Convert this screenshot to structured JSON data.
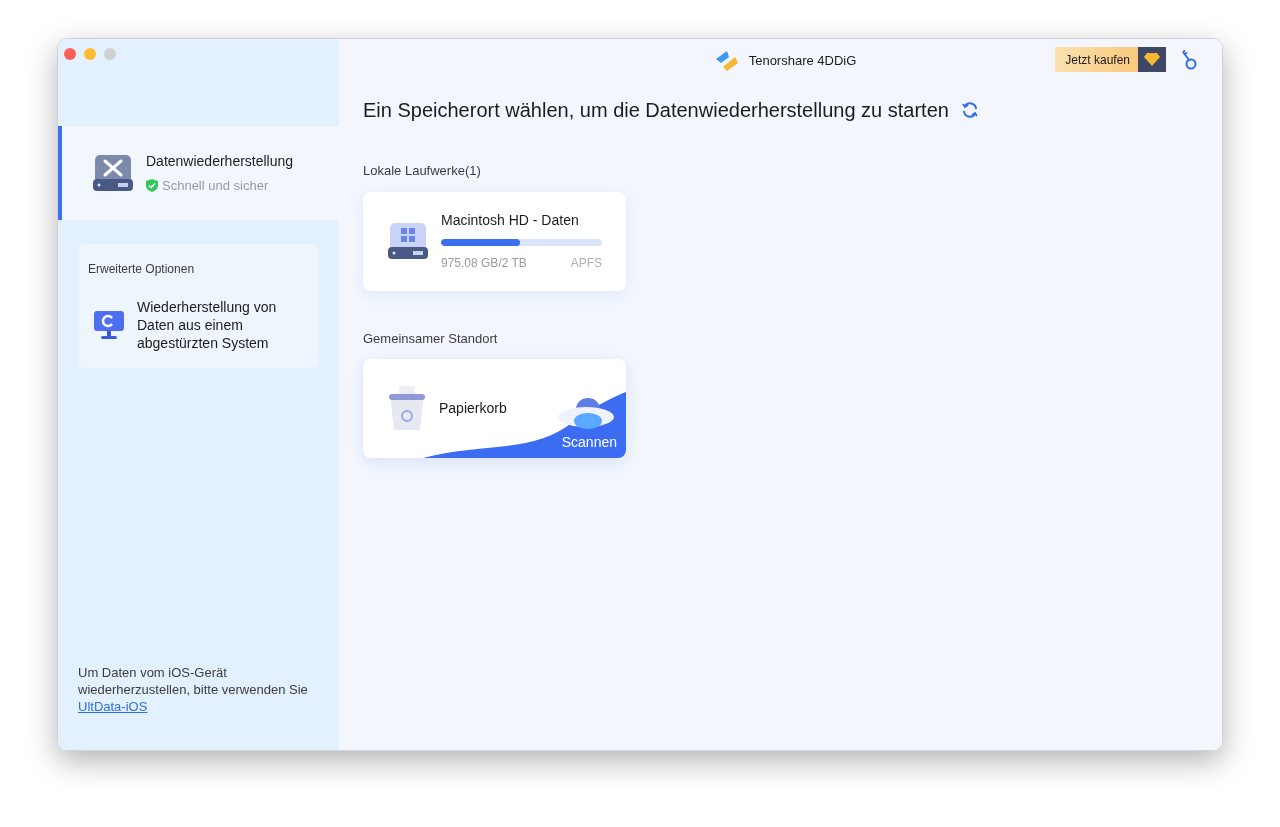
{
  "window": {
    "title": "Tenorshare 4DDiG"
  },
  "buy_button": {
    "label": "Jetzt kaufen"
  },
  "sidebar": {
    "items": [
      {
        "title": "Datenwiederherstellung",
        "subtitle": "Schnell und sicher",
        "selected": true
      }
    ],
    "advanced": {
      "heading": "Erweiterte Optionen",
      "items": [
        {
          "title": "Wiederherstellung von Daten aus einem abgestürzten System",
          "selected": false
        }
      ]
    },
    "footer": {
      "text": "Um Daten vom iOS-Gerät wiederherzustellen, bitte verwenden Sie",
      "link": "UltData-iOS"
    }
  },
  "heading": "Ein Speicherort wählen, um die Datenwiederherstellung zu starten",
  "sections": [
    {
      "title": "Lokale Laufwerke(1)",
      "cards": [
        {
          "kind": "drive",
          "name": "Macintosh HD - Daten",
          "level": 0.49,
          "size": "975.08 GB/2 TB",
          "filesystem": "APFS"
        }
      ]
    },
    {
      "title": "Gemeinsamer Standort",
      "cards": [
        {
          "kind": "trash",
          "name": "Papierkorb",
          "action": "Scannen"
        }
      ]
    }
  ]
}
